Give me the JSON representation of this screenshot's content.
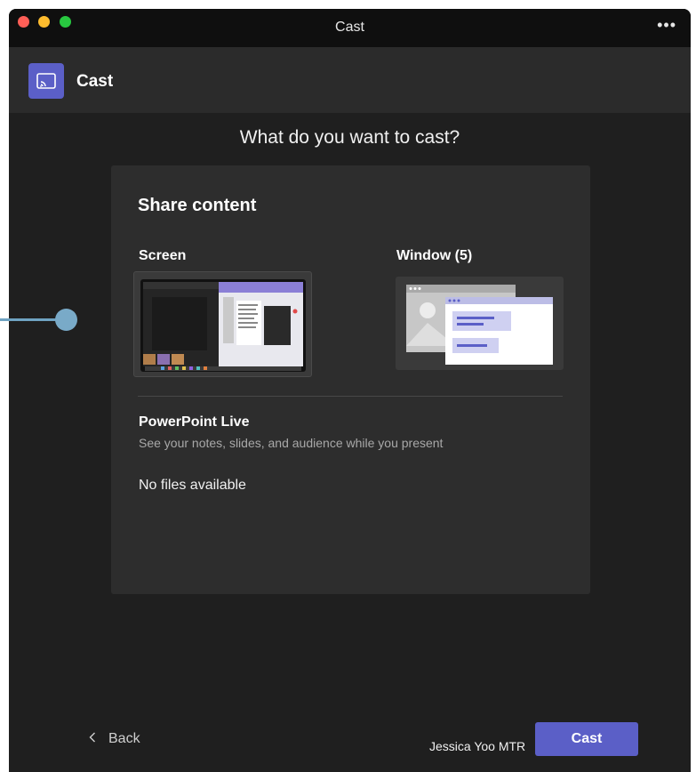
{
  "titlebar": {
    "title": "Cast",
    "more_label": "•••"
  },
  "header": {
    "title": "Cast"
  },
  "main": {
    "question": "What do you want to cast?"
  },
  "share": {
    "heading": "Share content",
    "screen_label": "Screen",
    "window_label": "Window (5)"
  },
  "powerpoint": {
    "title": "PowerPoint Live",
    "description": "See your notes, slides, and audience while you present",
    "empty_text": "No files available"
  },
  "footer": {
    "back_label": "Back",
    "device_name": "Jessica Yoo MTR",
    "cast_label": "Cast"
  },
  "colors": {
    "accent": "#5b5fc7",
    "background": "#1f1f1f",
    "panel": "#2d2d2d",
    "pointer": "#79aac8"
  }
}
